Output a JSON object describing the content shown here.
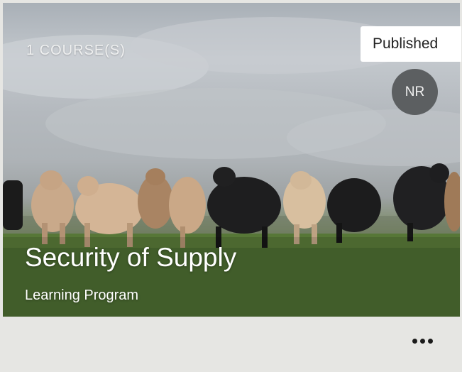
{
  "card": {
    "course_count": "1 COURSE(S)",
    "status": "Published",
    "avatar_initials": "NR",
    "title": "Security of Supply",
    "type_label": "Learning Program"
  },
  "footer": {
    "menu_icon": "more-horizontal-icon"
  },
  "colors": {
    "badge_bg": "#ffffff",
    "avatar_bg": "#5c5f61",
    "footer_bg": "#e6e6e3"
  }
}
